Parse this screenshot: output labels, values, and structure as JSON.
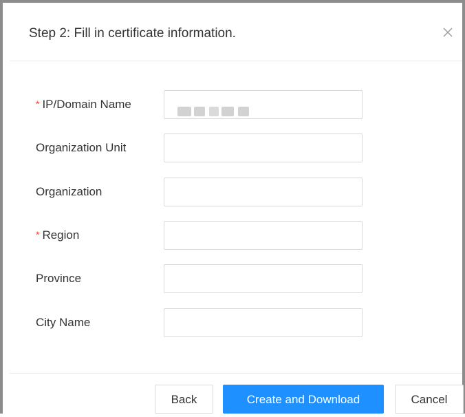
{
  "dialog": {
    "title": "Step 2: Fill in certificate information.",
    "close_icon": "close-icon"
  },
  "form": {
    "fields": [
      {
        "label": "IP/Domain Name",
        "required": true,
        "value": "",
        "placeholder": ""
      },
      {
        "label": "Organization Unit",
        "required": false,
        "value": "",
        "placeholder": ""
      },
      {
        "label": "Organization",
        "required": false,
        "value": "",
        "placeholder": ""
      },
      {
        "label": "Region",
        "required": true,
        "value": "",
        "placeholder": ""
      },
      {
        "label": "Province",
        "required": false,
        "value": "",
        "placeholder": ""
      },
      {
        "label": "City Name",
        "required": false,
        "value": "",
        "placeholder": ""
      }
    ],
    "required_marker": "*"
  },
  "footer": {
    "back_label": "Back",
    "create_label": "Create and Download",
    "cancel_label": "Cancel"
  },
  "colors": {
    "primary": "#1e90ff",
    "required": "#f04134",
    "text": "#333333",
    "border": "#d9d9d9"
  }
}
